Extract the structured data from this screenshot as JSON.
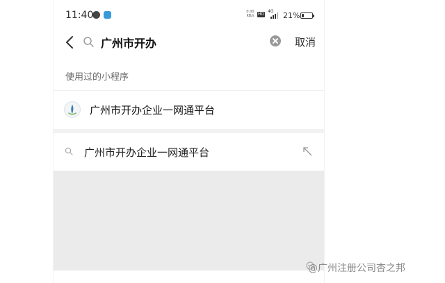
{
  "status_bar": {
    "time": "11:40",
    "net_speed_value": "0.00",
    "net_speed_unit": "KB/s",
    "hd_label": "HD",
    "signal_label": "4G",
    "battery_percent": "21%",
    "battery_level": 0.21
  },
  "search": {
    "query": "广州市开办",
    "cancel_label": "取消"
  },
  "recent_section": {
    "title": "使用过的小程序",
    "items": [
      {
        "name": "广州市开办企业一网通平台",
        "icon": "app-logo-icon"
      }
    ]
  },
  "suggestions": [
    {
      "text": "广州市开办企业一网通平台",
      "icon": "search-icon",
      "action_icon": "fill-arrow-icon"
    }
  ],
  "watermark": {
    "text": "@广州注册公司杏之邦"
  },
  "colors": {
    "app_badge": "#3a9ad9",
    "divider_band": "#f2f2f2",
    "empty_area": "#ebebeb"
  }
}
